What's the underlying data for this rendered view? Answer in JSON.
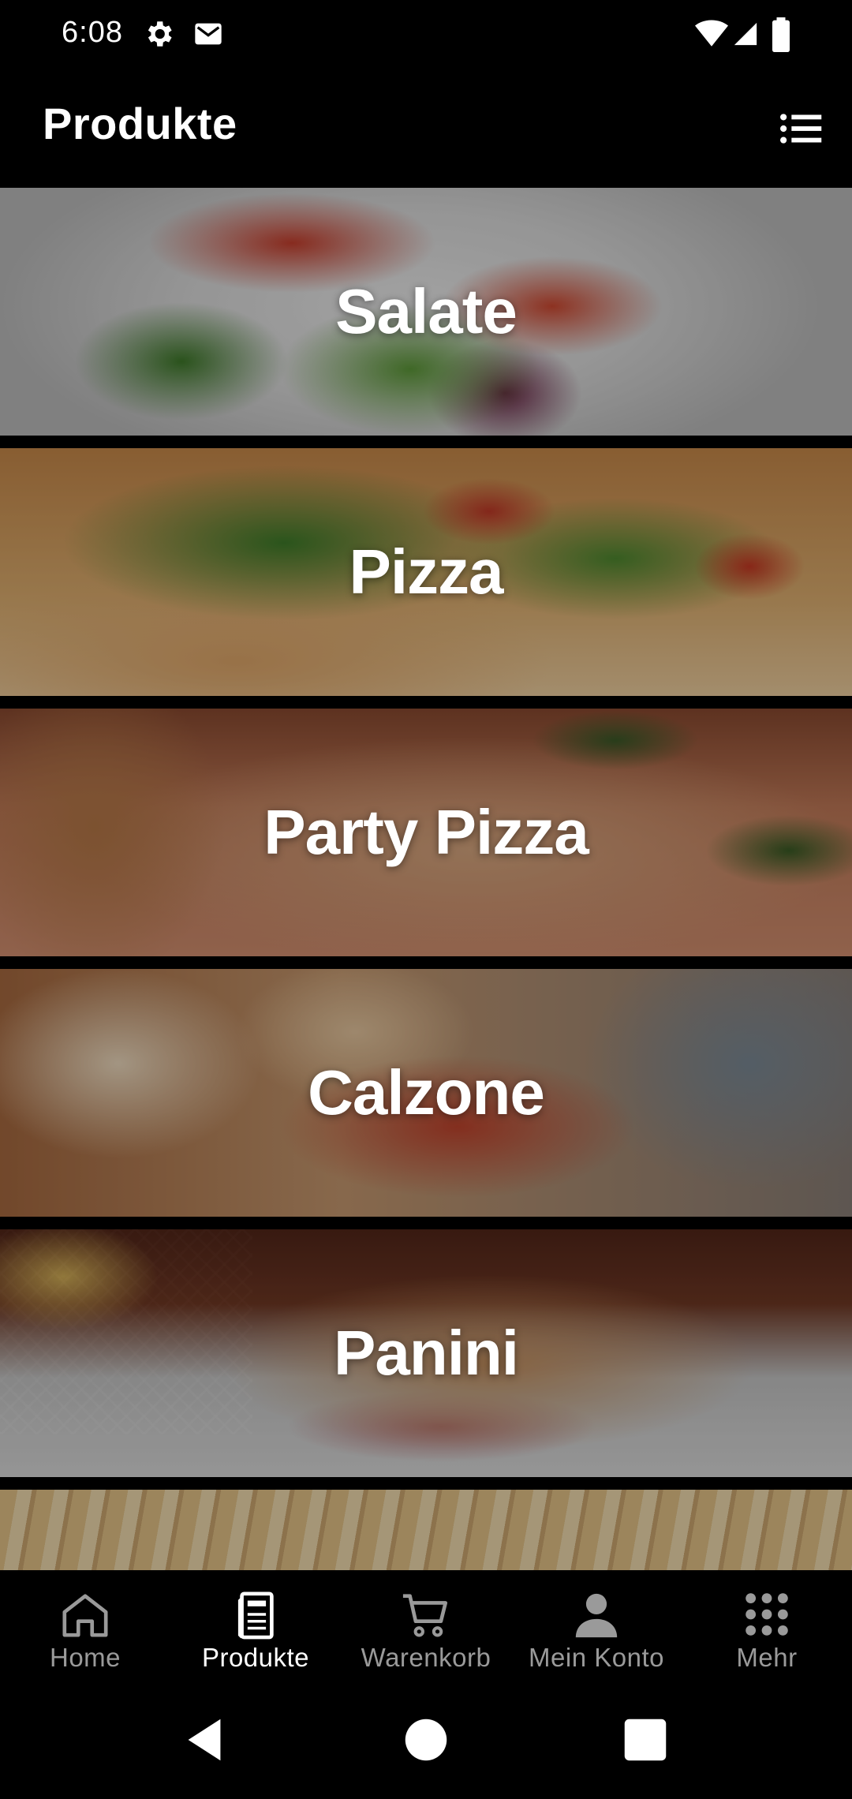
{
  "status_bar": {
    "time": "6:08",
    "icons": [
      "gear-icon",
      "mail-icon",
      "wifi-icon",
      "signal-icon",
      "battery-icon"
    ]
  },
  "app_bar": {
    "title": "Produkte",
    "menu_icon": "list-icon"
  },
  "categories": [
    {
      "label": "Salate"
    },
    {
      "label": "Pizza"
    },
    {
      "label": "Party Pizza"
    },
    {
      "label": "Calzone"
    },
    {
      "label": "Panini"
    },
    {
      "label": ""
    }
  ],
  "bottom_nav": {
    "items": [
      {
        "label": "Home",
        "icon": "home-icon"
      },
      {
        "label": "Produkte",
        "icon": "menu-card-icon"
      },
      {
        "label": "Warenkorb",
        "icon": "cart-icon"
      },
      {
        "label": "Mein Konto",
        "icon": "account-icon"
      },
      {
        "label": "Mehr",
        "icon": "grid-icon"
      }
    ],
    "active_index": 1
  },
  "system_nav": {
    "icons": [
      "back-icon",
      "home-circle-icon",
      "recents-icon"
    ]
  },
  "colors": {
    "background": "#000000",
    "active": "#ffffff",
    "inactive": "#9a9a9a"
  }
}
